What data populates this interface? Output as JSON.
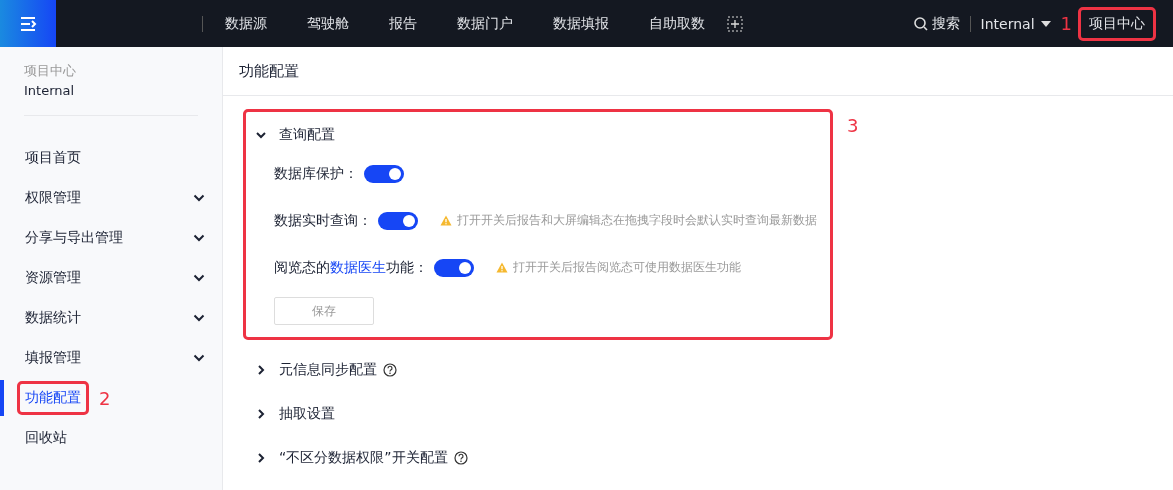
{
  "topbar": {
    "nav": [
      {
        "label": "数据源"
      },
      {
        "label": "驾驶舱"
      },
      {
        "label": "报告"
      },
      {
        "label": "数据门户"
      },
      {
        "label": "数据填报"
      },
      {
        "label": "自助取数"
      }
    ],
    "search": "搜索",
    "workspace": "Internal",
    "project_button": {
      "label": "项目中心",
      "highlighted": true,
      "annotation": "1"
    }
  },
  "sidebar": {
    "caption": "项目中心",
    "workspace": "Internal",
    "items": [
      {
        "label": "项目首页",
        "expandable": false,
        "selected": false,
        "highlighted": false
      },
      {
        "label": "权限管理",
        "expandable": true,
        "selected": false,
        "highlighted": false
      },
      {
        "label": "分享与导出管理",
        "expandable": true,
        "selected": false,
        "highlighted": false
      },
      {
        "label": "资源管理",
        "expandable": true,
        "selected": false,
        "highlighted": false
      },
      {
        "label": "数据统计",
        "expandable": true,
        "selected": false,
        "highlighted": false
      },
      {
        "label": "填报管理",
        "expandable": true,
        "selected": false,
        "highlighted": false
      },
      {
        "label": "功能配置",
        "expandable": false,
        "selected": true,
        "highlighted": true,
        "annotation": "2"
      },
      {
        "label": "回收站",
        "expandable": false,
        "selected": false,
        "highlighted": false
      }
    ]
  },
  "page_title": "功能配置",
  "sections": [
    {
      "title": "查询配置",
      "expanded": true,
      "help": false,
      "highlighted": true,
      "annotation": "3",
      "settings": [
        {
          "label": "数据库保护：",
          "on": true
        },
        {
          "label": "数据实时查询：",
          "on": true,
          "hint": "打开开关后报告和大屏编辑态在拖拽字段时会默认实时查询最新数据"
        },
        {
          "label": "阅览态的",
          "link": "数据医生",
          "label_suffix": "功能：",
          "on": true,
          "hint": "打开开关后报告阅览态可使用数据医生功能"
        }
      ],
      "save_button": "保存"
    },
    {
      "title": "元信息同步配置",
      "expanded": false,
      "help": true,
      "highlighted": false
    },
    {
      "title": "抽取设置",
      "expanded": false,
      "help": false,
      "highlighted": false
    },
    {
      "title": "“不区分数据权限”开关配置",
      "expanded": false,
      "help": true,
      "highlighted": false
    }
  ]
}
